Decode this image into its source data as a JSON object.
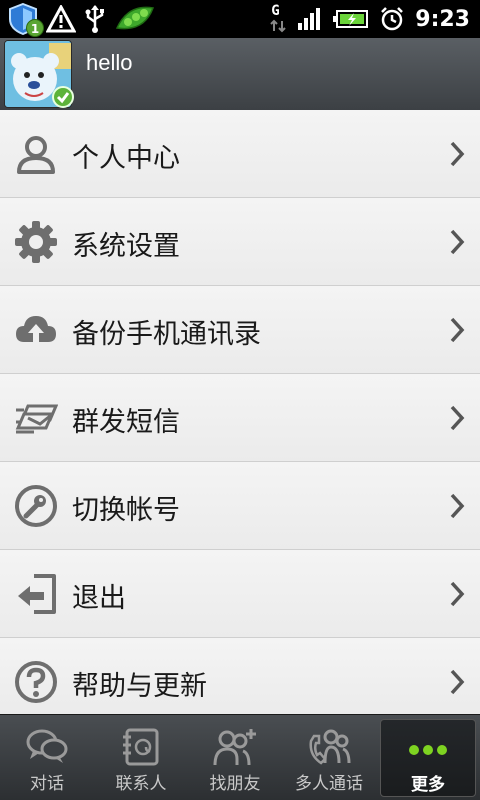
{
  "status_bar": {
    "time": "9:23",
    "notification_badge": "1",
    "network_type": "G",
    "icons": [
      "shield-icon",
      "warning-icon",
      "usb-icon",
      "peas-icon",
      "network-icon",
      "signal-icon",
      "battery-icon",
      "alarm-icon"
    ]
  },
  "profile": {
    "name": "hello",
    "status": "online"
  },
  "menu": {
    "items": [
      {
        "label": "个人中心",
        "icon": "person-icon"
      },
      {
        "label": "系统设置",
        "icon": "gear-icon"
      },
      {
        "label": "备份手机通讯录",
        "icon": "cloud-upload-icon"
      },
      {
        "label": "群发短信",
        "icon": "mass-message-icon"
      },
      {
        "label": "切换帐号",
        "icon": "key-icon"
      },
      {
        "label": "退出",
        "icon": "exit-icon"
      },
      {
        "label": "帮助与更新",
        "icon": "help-icon"
      }
    ]
  },
  "tabbar": {
    "tabs": [
      {
        "label": "对话",
        "icon": "chat-bubbles-icon"
      },
      {
        "label": "联系人",
        "icon": "contacts-book-icon"
      },
      {
        "label": "找朋友",
        "icon": "add-friend-icon"
      },
      {
        "label": "多人通话",
        "icon": "group-call-icon"
      },
      {
        "label": "更多",
        "icon": "more-dots-icon"
      }
    ],
    "active_tab": "更多"
  },
  "colors": {
    "online_green": "#5cb33a",
    "more_dots_green": "#7ed321",
    "menu_text": "#1a1a1a",
    "icon_gray": "#6e6e6e"
  }
}
